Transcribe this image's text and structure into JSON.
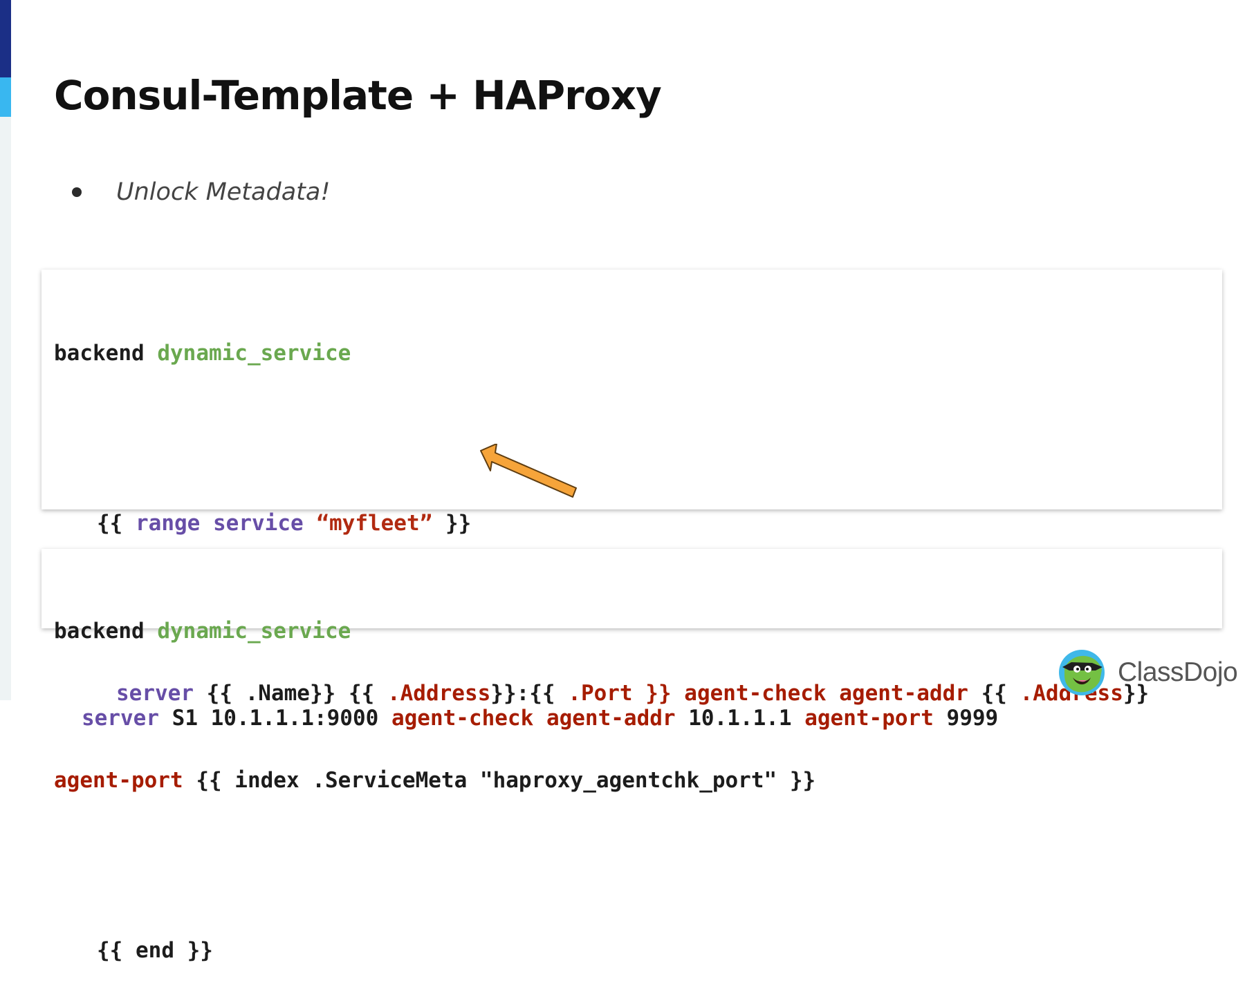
{
  "slide": {
    "title": "Consul-Template + HAProxy",
    "bullet": "Unlock Metadata!"
  },
  "template_code": {
    "line1_keyword": "backend",
    "line1_name": "dynamic_service",
    "line2_open": "{{",
    "line2_range": "range",
    "line2_service": "service",
    "line2_quote_value": "“myfleet”",
    "line2_close": "}}",
    "line3_server": "server",
    "line3_name_expr": "{{ .Name}}",
    "line3_addr_open": "{{",
    "line3_address": ".Address",
    "line3_addr_close": "}}:{{",
    "line3_port": ".Port",
    "line3_port_close": "}}",
    "line3_agent_check": "agent-check",
    "line3_agent_addr": "agent-addr",
    "line3_addr2_open": "{{",
    "line3_address2": ".Address",
    "line3_addr2_close": "}}",
    "line4_agent_port": "agent-port",
    "line4_expr": "{{ index .ServiceMeta \"haproxy_agentchk_port\" }}",
    "line5_end": "{{ end }}"
  },
  "rendered_code": {
    "line1_keyword": "backend",
    "line1_name": "dynamic_service",
    "line2_server": "server",
    "line2_target": "S1 10.1.1.1:9000",
    "line2_agent_check": "agent-check",
    "line2_agent_addr": "agent-addr",
    "line2_addr_value": "10.1.1.1",
    "line2_agent_port": "agent-port",
    "line2_port_value": "9999"
  },
  "brand": {
    "name": "ClassDojo",
    "icon": "classdojo-monster-logo"
  },
  "colors": {
    "accent_dark": "#1b2f86",
    "accent_light": "#39b7f0",
    "code_green": "#6aa84f",
    "code_purple": "#674ea7",
    "code_red": "#a61c00",
    "arrow_fill": "#f6a43a"
  }
}
